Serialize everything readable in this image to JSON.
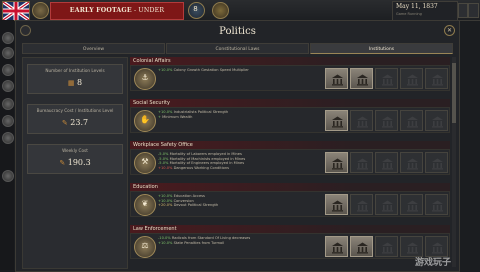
{
  "topbar": {
    "banner_bold": "EARLY FOOTAGE",
    "banner_rest": " - UNDER DEVELOPMENT",
    "counter": "8",
    "date": "May 11, 1837",
    "date_sub": "Game Running",
    "flag_icon": "union-jack-flag",
    "crest_icon": "coat-of-arms-icon"
  },
  "panel": {
    "title": "Politics",
    "tabs": [
      {
        "label": "Overview",
        "active": false
      },
      {
        "label": "Constitutional Laws",
        "active": false
      },
      {
        "label": "Institutions",
        "active": true
      }
    ]
  },
  "left": {
    "boxes": [
      {
        "title": "Number of Institution Levels",
        "value": "8",
        "icon": "institution-icon"
      },
      {
        "title": "Bureaucracy Cost / Institutions Level",
        "value": "23.7",
        "icon": "bureaucracy-icon"
      },
      {
        "title": "Weekly Cost",
        "value": "190.3",
        "icon": "bureaucracy-icon"
      }
    ]
  },
  "sections": [
    {
      "title": "Colonial Affairs",
      "icon": "ship-icon",
      "effects": [
        {
          "value": "+10.0%",
          "tone": "g",
          "text": " Colony Growth Gestation Speed Multiplier"
        }
      ],
      "slots_on": 2
    },
    {
      "title": "Social Security",
      "icon": "hands-icon",
      "effects": [
        {
          "value": "+10.0%",
          "tone": "g",
          "text": " Industrialists Political Strength"
        },
        {
          "value": "+",
          "tone": "g",
          "text": " Minimum Wealth"
        }
      ],
      "slots_on": 1
    },
    {
      "title": "Workplace Safety Office",
      "icon": "worker-icon",
      "effects": [
        {
          "value": "-5.0%",
          "tone": "g",
          "text": " Mortality of Laborers employed in Mines"
        },
        {
          "value": "-5.0%",
          "tone": "g",
          "text": " Mortality of Machinists employed in Mines"
        },
        {
          "value": "-5.0%",
          "tone": "g",
          "text": " Mortality of Engineers employed in Mines"
        },
        {
          "value": "+10.0%",
          "tone": "r",
          "text": " Dangerous Working Conditions"
        }
      ],
      "slots_on": 1
    },
    {
      "title": "Education",
      "icon": "book-icon",
      "effects": [
        {
          "value": "+10.0%",
          "tone": "g",
          "text": " Education Access"
        },
        {
          "value": "+10.0%",
          "tone": "g",
          "text": " Conversion"
        },
        {
          "value": "+20.0%",
          "tone": "y",
          "text": " Devout Political Strength"
        }
      ],
      "slots_on": 1
    },
    {
      "title": "Law Enforcement",
      "icon": "gavel-icon",
      "effects": [
        {
          "value": "-10.0%",
          "tone": "g",
          "text": " Radicals from Standard Of Living decreases"
        },
        {
          "value": "+10.0%",
          "tone": "g",
          "text": " State Penalties from Turmoil"
        }
      ],
      "slots_on": 2
    }
  ],
  "watermark": "游戏玩子"
}
